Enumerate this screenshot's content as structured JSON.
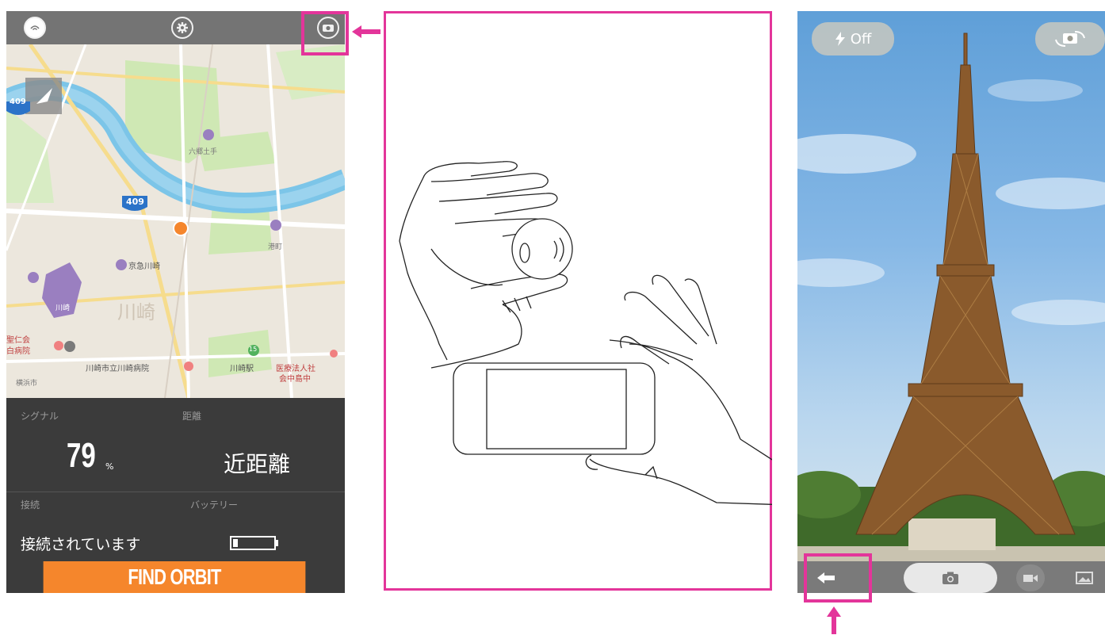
{
  "map_app": {
    "signal_label": "シグナル",
    "signal_value": "79",
    "signal_unit": "%",
    "distance_label": "距離",
    "distance_value": "近距離",
    "connection_label": "接続",
    "connection_value": "接続されています",
    "battery_label": "バッテリー",
    "battery_level": 0.12,
    "find_button": "FIND ORBIT",
    "map_labels": {
      "highway_a": "409",
      "highway_b": "409",
      "station_1": "京急川崎",
      "station_2": "川崎",
      "hospital": "川崎市立川崎病院",
      "hospital_2": "川崎駅",
      "medical": "医療法人社",
      "medical_2": "会中島中",
      "osaka": "六郷土手",
      "shinkawa": "港町",
      "left_label": "聖仁会",
      "left_label_2": "白病院",
      "corner_label": "横浜市",
      "poi_num": "15",
      "poi_small": "川崎"
    }
  },
  "camera_app": {
    "flash_label": "Off"
  },
  "colors": {
    "highlight": "#e3359a",
    "accent_orange": "#f5862c"
  }
}
